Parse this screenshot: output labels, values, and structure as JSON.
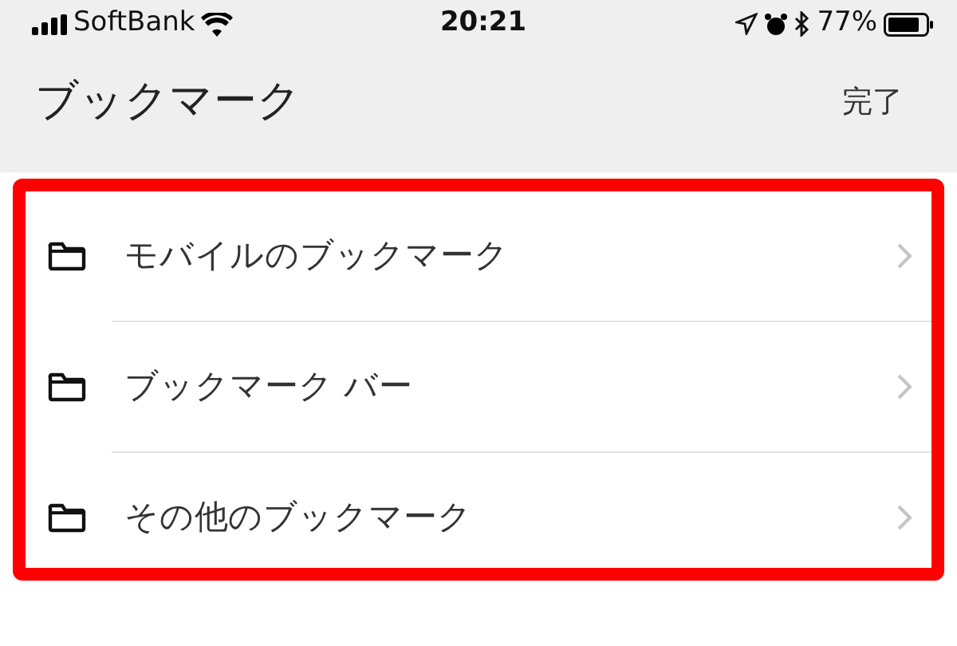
{
  "status_bar": {
    "carrier": "SoftBank",
    "time": "20:21",
    "battery": "77%"
  },
  "header": {
    "title": "ブックマーク",
    "done": "完了"
  },
  "folders": [
    {
      "label": "モバイルのブックマーク"
    },
    {
      "label": "ブックマーク バー"
    },
    {
      "label": "その他のブックマーク"
    }
  ]
}
